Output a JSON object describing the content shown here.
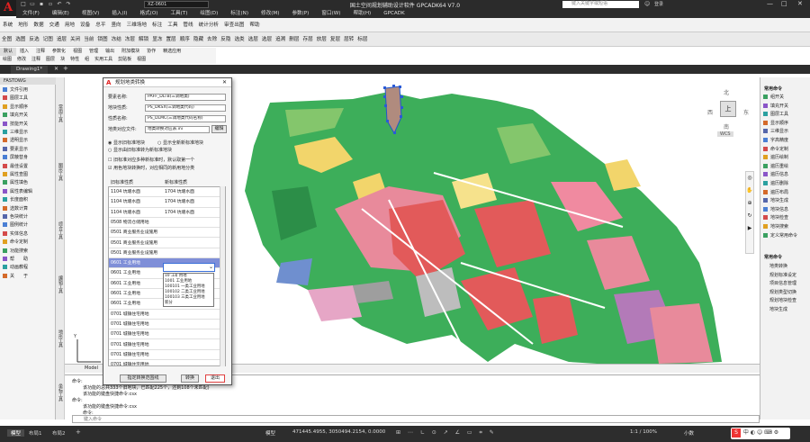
{
  "app": {
    "title": "国土空间规划辅助设计软件 GPCADK64 V7.0",
    "logo": "A",
    "quick_combo": "XZ-0601",
    "search_placeholder": "键入关键字或短语",
    "user": "登录",
    "colors": {
      "title_bg": "#2b2b2b",
      "logo_red": "#e02020",
      "ok_red": "#e04040"
    }
  },
  "menubar": [
    "文件(F)",
    "编辑(E)",
    "视图(V)",
    "插入(I)",
    "格式(O)",
    "工具(T)",
    "绘图(D)",
    "标注(N)",
    "修改(M)",
    "参数(P)",
    "窗口(W)",
    "帮助(H)",
    "GPCADK"
  ],
  "ribbon_row1": [
    "系统",
    "地形",
    "数据",
    "交通",
    "用地",
    "设备",
    "总平",
    "竖向",
    "三维场地",
    "标注",
    "工具",
    "管线",
    "统计分析",
    "审查出图",
    "帮助"
  ],
  "ribbon_row2": [
    "全图",
    "选图",
    "反选",
    "记图",
    "追层",
    "关闭",
    "当前",
    "锁图",
    "冻结",
    "冻层",
    "解锁",
    "显冻",
    "置层",
    "顺序",
    "隐藏",
    "去除",
    "反隐",
    "选类",
    "选层",
    "选层",
    "追溯",
    "删层",
    "存层",
    "放层",
    "复层",
    "层转",
    "标层"
  ],
  "ribbon_row3": [
    "默认",
    "插入",
    "注释",
    "参数化",
    "视图",
    "管理",
    "输出",
    "附加模块",
    "协作",
    "精选应用"
  ],
  "ribbon_row4": [
    "绘图",
    "修改",
    "注释",
    "图层",
    "块",
    "特性",
    "组",
    "实用工具",
    "剪贴板",
    "视图"
  ],
  "doc_tabs": {
    "tab1": "Drawing1*",
    "plus": "+"
  },
  "left_panel": {
    "title": "FASTDWG",
    "items": [
      "文件引用",
      "图层工具",
      "显示顺序",
      "填充开关",
      "技能开关",
      "三维显示",
      "透明显示",
      "要素显示",
      "屏蔽替身",
      "最佳设置",
      "属性查图",
      "属性填色",
      "属性表编辑",
      "长度面积",
      "选数计算",
      "色块统计",
      "图例统计",
      "实体信息",
      "命令定制",
      "功能搜索",
      "帮　　助",
      "动画教程",
      "关　　于"
    ]
  },
  "vertical_labels": [
    "常用工具",
    "图形工具",
    "综合工具",
    "编辑工具",
    "地形工具",
    "坐标工具"
  ],
  "right_panel": {
    "header": "常用命令",
    "items": [
      "组开关",
      "填充开关",
      "图层工具",
      "显示顺序",
      "三维显示",
      "字高精度",
      "命令定制",
      "遍历绘制",
      "遍历重绘",
      "遍历信息",
      "遍历删除",
      "遍历布局",
      "地块生成",
      "地块信息",
      "地块检查",
      "地块搜索",
      "定义常用命令"
    ],
    "header2": "常用命令",
    "items2": [
      "地类转换",
      "规划标准设定",
      "项目信息管理",
      "规划类型切换",
      "规划地块检查",
      "地块生成"
    ]
  },
  "viewcube": {
    "north": "北",
    "south": "南",
    "east": "东",
    "west": "西",
    "top": "上",
    "wcs": "WCS"
  },
  "model_tab": "Model",
  "dialog": {
    "title": "规划地类转换",
    "fields": [
      {
        "label": "要素名称:",
        "value": "PAFF_DLTB(三调地类)"
      },
      {
        "label": "地块性质:",
        "value": "PS_DKSX(三调地类代码)"
      },
      {
        "label": "性质名称:",
        "value": "PS_DLMC(三调地类代码名称)"
      },
      {
        "label": "地类对应文件:",
        "value": "地类转换对应表.ini"
      }
    ],
    "edit_button": "编辑",
    "radio1": "显示旧标准地块",
    "radio2": "显示全新新标准地块",
    "radio3": "显示由旧标准转为新标准地块",
    "check1": "旧标准对应多种新标准时，默认取第一个",
    "check2": "用色地块转换时，对应相同的新用地分类",
    "col_old": "旧标准性质",
    "col_new": "新标准性质",
    "rows": [
      {
        "old": "1104 坑塘水面",
        "new": "1704 坑塘水面"
      },
      {
        "old": "1104 坑塘水面",
        "new": "1704 坑塘水面"
      },
      {
        "old": "1104 坑塘水面",
        "new": "1704 坑塘水面"
      },
      {
        "old": "0508 物流仓储用地",
        "new": ""
      },
      {
        "old": "0501 商业服务业设施用",
        "new": ""
      },
      {
        "old": "0501 商业服务业设施用",
        "new": ""
      },
      {
        "old": "0501 商业服务业设施用",
        "new": ""
      },
      {
        "old": "0601 工业用地",
        "new": ""
      },
      {
        "old": "0601 工业用地",
        "new": ""
      },
      {
        "old": "0601 工业用地",
        "new": ""
      },
      {
        "old": "0601 工业用地",
        "new": ""
      },
      {
        "old": "0601 工业用地",
        "new": ""
      },
      {
        "old": "0701 城镇住宅用地",
        "new": ""
      },
      {
        "old": "0701 城镇住宅用地",
        "new": ""
      },
      {
        "old": "0701 城镇住宅用地",
        "new": ""
      },
      {
        "old": "0701 城镇住宅用地",
        "new": ""
      },
      {
        "old": "0701 城镇住宅用地",
        "new": ""
      },
      {
        "old": "0701 城镇住宅用地",
        "new": ""
      }
    ],
    "dropdown_options": [
      "10 工矿用地",
      "1001 工业用地",
      "100101 一类工业用地",
      "100102 二类工业用地",
      "100103 三类工业用地",
      "新分"
    ],
    "btn_batch": "指定转换范围线",
    "btn_convert": "转换",
    "btn_exit": "退出"
  },
  "command": {
    "lines": [
      "命令:",
      "该功能的总共333个旧地块，已匹配225个，还剩108个未匹配)",
      "该功能的键盘快捷命令:csx",
      "命令:",
      "该功能的键盘快捷命令:csx",
      "命令:"
    ],
    "input_placeholder": "键入命令"
  },
  "status": {
    "tabs": [
      "模型",
      "布局1",
      "布局2"
    ],
    "mode": "模型",
    "coords": "471445.4955, 3050494.2154, 0.0000",
    "scale": "1:1 / 100%",
    "unit": "小数",
    "ime": "中"
  }
}
